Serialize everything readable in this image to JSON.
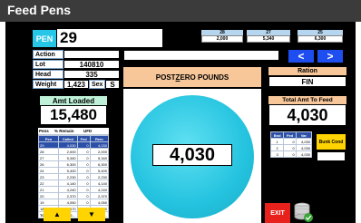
{
  "window": {
    "title": "Feed Pens"
  },
  "pen": {
    "label": "PEN",
    "value": "29"
  },
  "header_stats": [
    {
      "label": "28",
      "value": "2,000"
    },
    {
      "label": "27",
      "value": "5,340"
    },
    {
      "label": "25",
      "value": "6,300"
    }
  ],
  "fields": {
    "action_label": "Action",
    "action_value": "",
    "lot_label": "Lot",
    "lot_value": "140810",
    "head_label": "Head",
    "head_value": "335",
    "sex_label": "Sex",
    "sex_value": "S",
    "weight_label": "Weight",
    "weight_value": "1,423"
  },
  "nav": {
    "prev": "<",
    "next": ">"
  },
  "ration": {
    "label": "Ration",
    "value": "FIN"
  },
  "post_zero": {
    "label_pre": "POST ",
    "label_underlined": "Z",
    "label_post": "ERO POUNDS"
  },
  "scale_display": {
    "value": "4,030"
  },
  "amt_loaded": {
    "label": "Amt Loaded",
    "value": "15,480"
  },
  "total_amt": {
    "label": "Total Amt To Feed",
    "value": "4,030"
  },
  "pens_table": {
    "columns": [
      "Pens",
      "% Remain",
      "UFD"
    ],
    "subcolumns": [
      "Pen",
      "Called",
      "Fed",
      "Rem"
    ],
    "rows": [
      [
        "29",
        "4,030",
        "0",
        "4,030"
      ],
      [
        "28",
        "2,000",
        "0",
        "2,000"
      ],
      [
        "27",
        "5,340",
        "0",
        "5,340"
      ],
      [
        "26",
        "6,300",
        "0",
        "6,300"
      ],
      [
        "24",
        "5,400",
        "0",
        "5,400"
      ],
      [
        "23",
        "2,230",
        "0",
        "2,230"
      ],
      [
        "22",
        "4,140",
        "0",
        "4,140"
      ],
      [
        "21",
        "4,240",
        "0",
        "4,240"
      ],
      [
        "20",
        "2,370",
        "0",
        "2,370"
      ],
      [
        "19",
        "4,050",
        "0",
        "4,050"
      ],
      [
        "18",
        "4,670",
        "0",
        "4,670"
      ]
    ],
    "total": [
      "TOTAL",
      "47,6…",
      "0",
      "47,6…"
    ]
  },
  "bunk_table": {
    "columns": [
      "Bnd",
      "Fed",
      "Var"
    ],
    "rows": [
      [
        "1",
        "0",
        "4,030"
      ],
      [
        "2",
        "0",
        "4,030"
      ],
      [
        "3",
        "0",
        "4,030"
      ]
    ]
  },
  "bunk_cond": {
    "label": "Bunk Cond",
    "value": ""
  },
  "scroll": {
    "up": "▲",
    "down": "▼"
  },
  "exit_label": "EXIT",
  "colors": {
    "accent_cyan": "#26c6e8",
    "nav_blue": "#1f4ef0",
    "exit_red": "#e8211d",
    "bunk_yellow": "#ffd400"
  }
}
